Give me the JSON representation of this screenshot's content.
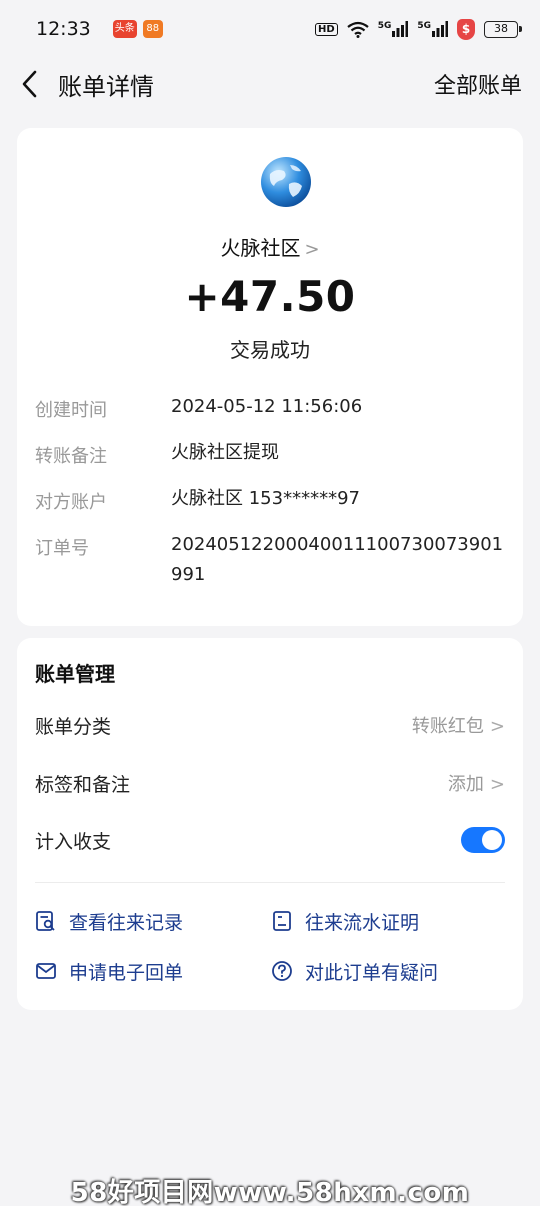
{
  "status_bar": {
    "time": "12:33",
    "app1": "头条",
    "app2": "88",
    "hd": "HD",
    "net1": "5G",
    "net2": "5G",
    "shield": "$",
    "battery": "38"
  },
  "nav": {
    "title": "账单详情",
    "right": "全部账单"
  },
  "summary": {
    "merchant": "火脉社区",
    "chevron": ">",
    "amount": "+47.50",
    "status": "交易成功"
  },
  "details": [
    {
      "label": "创建时间",
      "value": "2024-05-12 11:56:06"
    },
    {
      "label": "转账备注",
      "value": "火脉社区提现"
    },
    {
      "label": "对方账户",
      "value": "火脉社区 153******97"
    },
    {
      "label": "订单号",
      "value": "20240512200040011100730073901991"
    }
  ],
  "management": {
    "title": "账单管理",
    "category_label": "账单分类",
    "category_value": "转账红包",
    "tags_label": "标签和备注",
    "tags_value": "添加",
    "include_label": "计入收支",
    "include_on": true
  },
  "links": {
    "records": "查看往来记录",
    "statement": "往来流水证明",
    "receipt": "申请电子回单",
    "question": "对此订单有疑问"
  },
  "watermark": "58好项目网www.58hxm.com",
  "colors": {
    "accent": "#1677ff",
    "link": "#1d3d8f",
    "background": "#f4f4f6"
  }
}
